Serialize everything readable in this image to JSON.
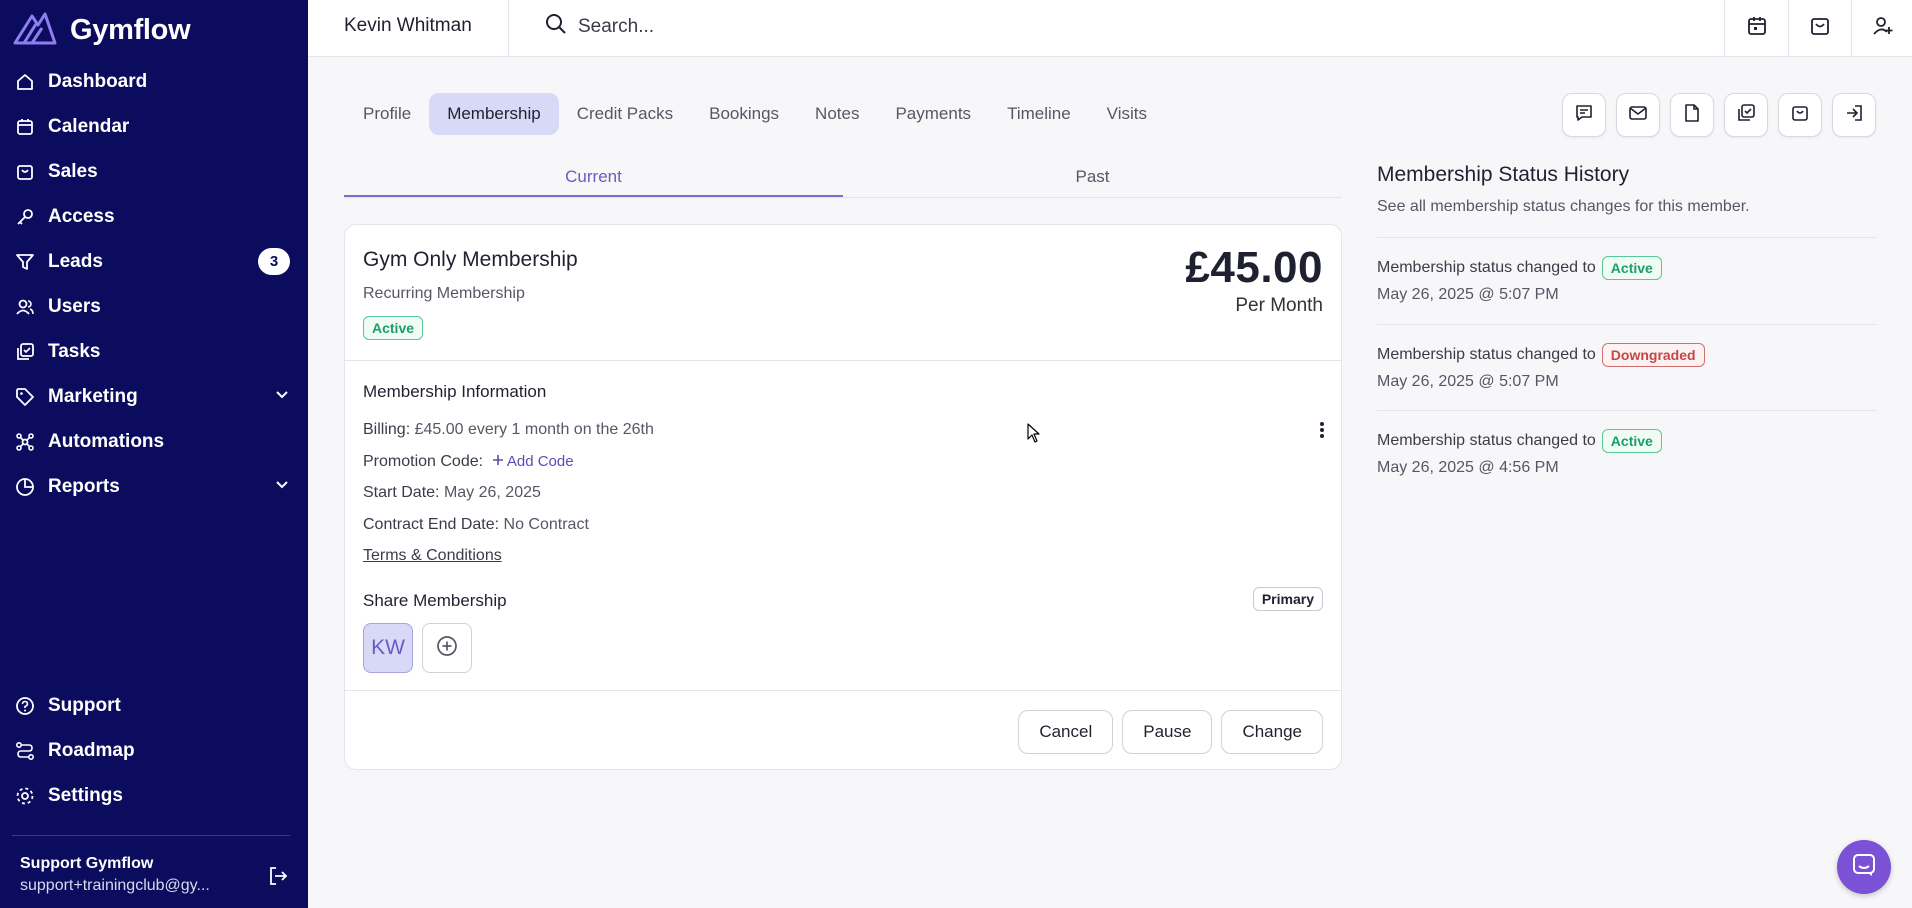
{
  "brand": {
    "name": "Gymflow"
  },
  "sidebar": {
    "items": [
      {
        "label": "Dashboard"
      },
      {
        "label": "Calendar"
      },
      {
        "label": "Sales"
      },
      {
        "label": "Access"
      },
      {
        "label": "Leads",
        "badge": "3"
      },
      {
        "label": "Users"
      },
      {
        "label": "Tasks"
      },
      {
        "label": "Marketing"
      },
      {
        "label": "Automations"
      },
      {
        "label": "Reports"
      }
    ],
    "bottom_items": [
      {
        "label": "Support"
      },
      {
        "label": "Roadmap"
      },
      {
        "label": "Settings"
      }
    ],
    "account": {
      "name": "Support Gymflow",
      "email": "support+trainingclub@gy..."
    }
  },
  "topbar": {
    "member_name": "Kevin Whitman",
    "search_placeholder": "Search..."
  },
  "tabs": [
    "Profile",
    "Membership",
    "Credit Packs",
    "Bookings",
    "Notes",
    "Payments",
    "Timeline",
    "Visits"
  ],
  "active_tab": "Membership",
  "subtabs": [
    "Current",
    "Past"
  ],
  "membership": {
    "title": "Gym Only Membership",
    "subtitle": "Recurring Membership",
    "status": "Active",
    "price": "£45.00",
    "period": "Per Month",
    "info_title": "Membership Information",
    "billing_label": "Billing:",
    "billing_value": "£45.00 every 1 month on the 26th",
    "promo_label": "Promotion Code:",
    "promo_action": "Add Code",
    "start_label": "Start Date:",
    "start_value": "May 26, 2025",
    "contract_label": "Contract End Date:",
    "contract_value": "No Contract",
    "terms": "Terms & Conditions",
    "share_title": "Share Membership",
    "primary_label": "Primary",
    "avatar_initials": "KW",
    "buttons": {
      "cancel": "Cancel",
      "pause": "Pause",
      "change": "Change"
    }
  },
  "history": {
    "title": "Membership Status History",
    "subtitle": "See all membership status changes for this member.",
    "entries": [
      {
        "text": "Membership status changed to",
        "status": "Active",
        "date": "May 26, 2025 @ 5:07 PM"
      },
      {
        "text": "Membership status changed to",
        "status": "Downgraded",
        "date": "May 26, 2025 @ 5:07 PM"
      },
      {
        "text": "Membership status changed to",
        "status": "Active",
        "date": "May 26, 2025 @ 4:56 PM"
      }
    ]
  },
  "colors": {
    "sidebar": "#0b0c5e",
    "accent": "#6b5bc4",
    "active_tab": "#d8d9f6",
    "active_green": "#1a9e6b",
    "downgraded_red": "#c04848",
    "chat": "#7b52d6"
  }
}
